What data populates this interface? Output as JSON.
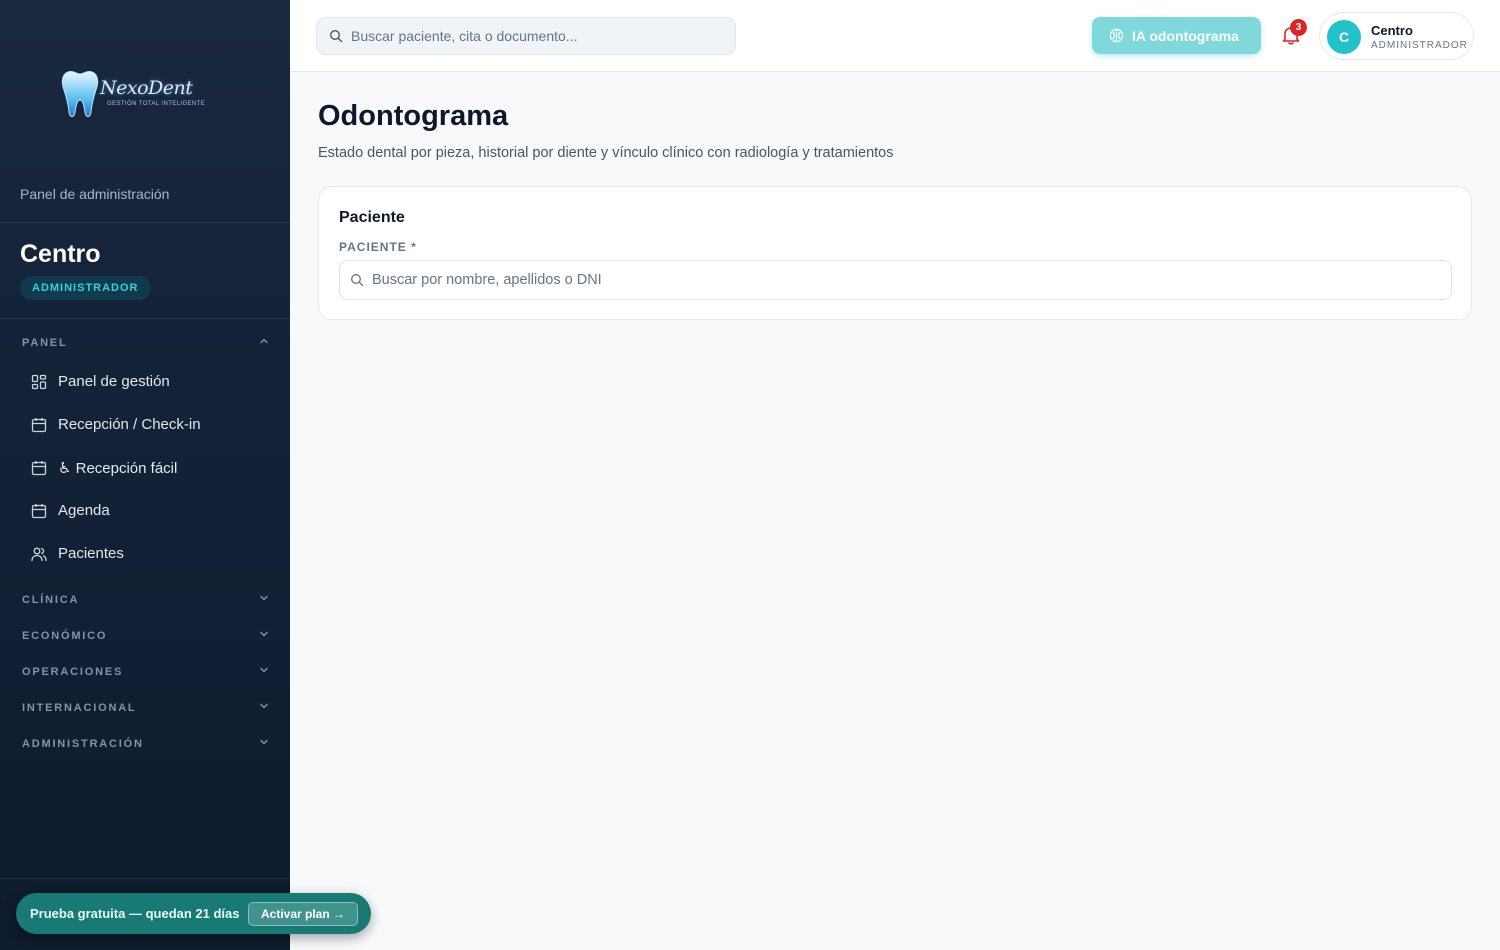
{
  "brand": {
    "name": "NexoDent",
    "tagline": "GESTIÓN TOTAL INTELIGENTE"
  },
  "sidebar": {
    "subtitle": "Panel de administración",
    "clinic_name": "Centro",
    "role_badge": "ADMINISTRADOR",
    "sections": [
      {
        "label": "PANEL",
        "expanded": true
      },
      {
        "label": "CLÍNICA",
        "expanded": false
      },
      {
        "label": "ECONÓMICO",
        "expanded": false
      },
      {
        "label": "OPERACIONES",
        "expanded": false
      },
      {
        "label": "INTERNACIONAL",
        "expanded": false
      },
      {
        "label": "ADMINISTRACIÓN",
        "expanded": false
      }
    ],
    "items": [
      {
        "label": "Panel de gestión",
        "icon": "grid-icon"
      },
      {
        "label": "Recepción / Check-in",
        "icon": "calendar-icon"
      },
      {
        "label": "♿ Recepción fácil",
        "icon": "calendar-icon"
      },
      {
        "label": "Agenda",
        "icon": "calendar-icon"
      },
      {
        "label": "Pacientes",
        "icon": "users-icon"
      }
    ]
  },
  "trial": {
    "text": "Prueba gratuita — quedan 21 días",
    "button": "Activar plan →"
  },
  "topbar": {
    "search_placeholder": "Buscar paciente, cita o documento...",
    "ai_button": "IA odontograma",
    "notifications_count": "3",
    "user": {
      "initial": "C",
      "name": "Centro",
      "role": "ADMINISTRADOR"
    }
  },
  "main": {
    "title": "Odontograma",
    "subtitle": "Estado dental por pieza, historial por diente y vínculo clínico con radiología y tratamientos",
    "card": {
      "title": "Paciente",
      "field_label": "PACIENTE *",
      "field_placeholder": "Buscar por nombre, apellidos o DNI"
    }
  },
  "colors": {
    "accent": "#22c3c8",
    "sidebar_bg": "#142238",
    "trial_bg": "#177a74",
    "badge": "#dc2626"
  }
}
